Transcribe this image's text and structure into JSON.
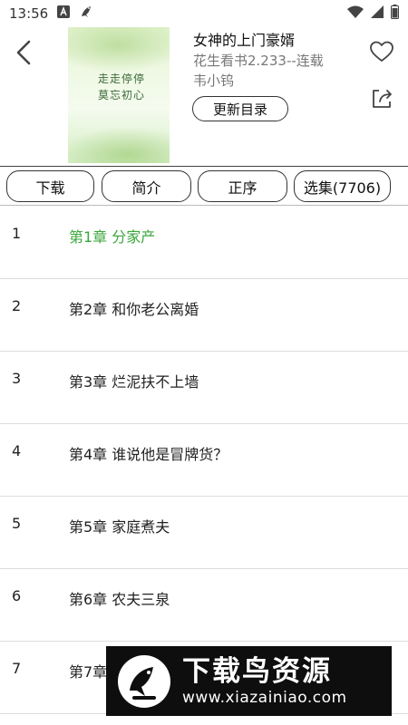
{
  "status_bar": {
    "time": "13:56"
  },
  "book": {
    "title": "女神的上门豪婿",
    "source": "花生看书2.233--连载",
    "author": "韦小钨",
    "update_button": "更新目录",
    "cover_text": [
      "走走停停",
      "莫忘初心"
    ]
  },
  "toolbar": {
    "download": "下载",
    "intro": "简介",
    "order": "正序",
    "select": "选集(7706)"
  },
  "chapters": [
    {
      "num": "1",
      "title": "第1章 分家产",
      "active": true
    },
    {
      "num": "2",
      "title": "第2章 和你老公离婚",
      "active": false
    },
    {
      "num": "3",
      "title": "第3章 烂泥扶不上墙",
      "active": false
    },
    {
      "num": "4",
      "title": "第4章 谁说他是冒牌货？",
      "active": false
    },
    {
      "num": "5",
      "title": "第5章 家庭煮夫",
      "active": false
    },
    {
      "num": "6",
      "title": "第6章 农夫三泉",
      "active": false
    },
    {
      "num": "7",
      "title": "第7章",
      "active": false
    }
  ],
  "watermark": {
    "name": "下载鸟资源",
    "url": "www.xiazainiao.com"
  },
  "colors": {
    "active_chapter": "#3aa63a",
    "watermark_bg": "#0e0e0e"
  }
}
